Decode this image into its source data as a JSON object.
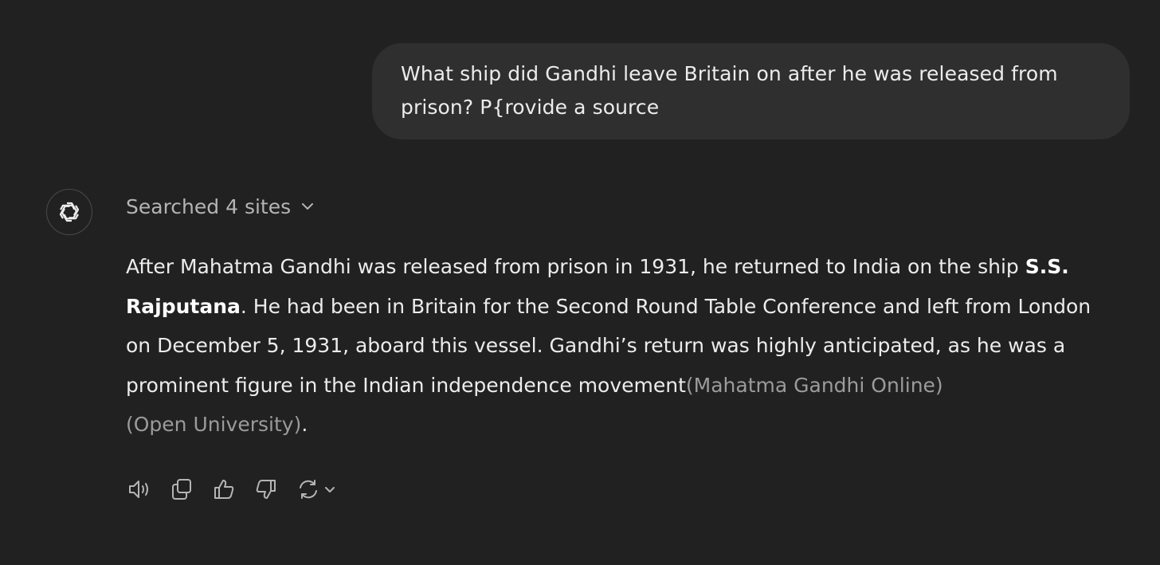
{
  "user_message": {
    "text": "What ship did Gandhi leave Britain on after he was released from prison? P{rovide a source"
  },
  "assistant": {
    "avatar_icon": "openai-logo-icon",
    "searched_label": "Searched 4 sites",
    "answer": {
      "part1": "After Mahatma Gandhi was released from prison in 1931, he returned to India on the ship ",
      "ship_name": "S.S. Rajputana",
      "part2": ". He had been in Britain for the Second Round Table Conference and left from London on December 5, 1931, aboard this vessel. Gandhi’s return was highly anticipated, as he was a prominent figure in the Indian independence movement",
      "citation1": "(Mahatma Gandhi Online)",
      "citation2": "(Open University)",
      "end": "."
    },
    "actions": [
      "read-aloud-icon",
      "copy-icon",
      "thumbs-up-icon",
      "thumbs-down-icon",
      "regenerate-icon"
    ]
  },
  "colors": {
    "background": "#212121",
    "user_bubble": "#2f2f2f",
    "text": "#ececec",
    "muted": "#b4b4b4",
    "citation": "#9b9b9b"
  }
}
